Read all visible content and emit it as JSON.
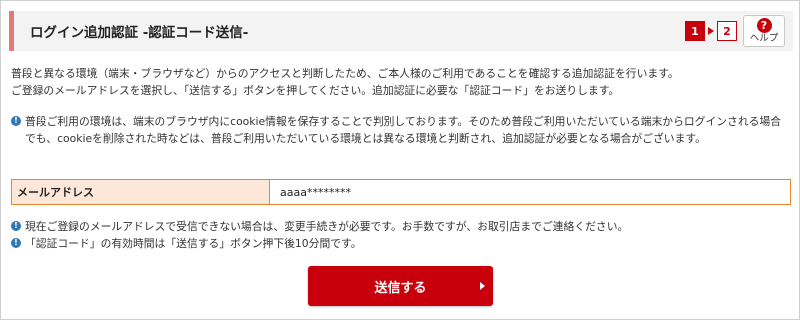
{
  "header": {
    "title": "ログイン追加認証 -認証コード送信-",
    "steps": [
      {
        "label": "1",
        "active": true
      },
      {
        "label": "2",
        "active": false
      }
    ],
    "help": {
      "icon": "question-icon",
      "glyph": "?",
      "label": "ヘルプ"
    }
  },
  "intro": {
    "line1": "普段と異なる環境（端末・ブラウザなど）からのアクセスと判断したため、ご本人様のご利用であることを確認する追加認証を行います。",
    "line2": "ご登録のメールアドレスを選択し、「送信する」ボタンを押してください。追加認証に必要な「認証コード」をお送りします。"
  },
  "notices": {
    "cookie": "普段ご利用の環境は、端末のブラウザ内にcookie情報を保存することで判別しております。そのため普段ご利用いただいている端末からログインされる場合でも、cookieを削除された時などは、普段ご利用いただいている環境とは異なる環境と判断され、追加認証が必要となる場合がございます。",
    "email_change": "現在ご登録のメールアドレスで受信できない場合は、変更手続きが必要です。お手数ですが、お取引店までご連絡ください。",
    "expiry": "「認証コード」の有効時間は「送信する」ボタン押下後10分間です。"
  },
  "email": {
    "label": "メールアドレス",
    "value": "aaaa********"
  },
  "send_button": {
    "label": "送信する"
  },
  "colors": {
    "accent_red": "#c8000b",
    "header_border": "#e27a7a",
    "info_blue": "#2f78b4",
    "email_border": "#e8862e",
    "email_label_bg": "#fce7d9"
  }
}
